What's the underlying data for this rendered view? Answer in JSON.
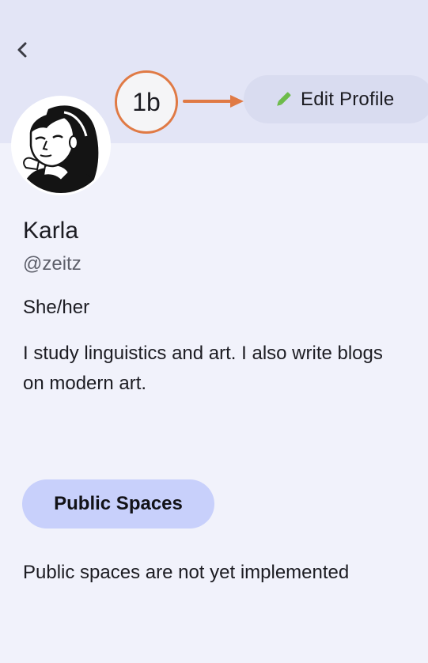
{
  "header": {
    "back_icon": "chevron-left-icon",
    "edit_profile_label": "Edit Profile",
    "edit_icon": "pencil-icon"
  },
  "annotation": {
    "label": "1b",
    "color": "#e07a45"
  },
  "profile": {
    "name": "Karla",
    "handle": "@zeitz",
    "pronouns": "She/her",
    "bio": "I study linguistics and art. I also write blogs on modern art."
  },
  "spaces": {
    "button_label": "Public Spaces",
    "note": "Public spaces are not yet implemented"
  },
  "colors": {
    "background": "#f1f2fb",
    "header_band": "#e3e5f6",
    "edit_button": "#d9dcf0",
    "pencil": "#6dbb4a",
    "spaces_button": "#c8d0fb"
  }
}
